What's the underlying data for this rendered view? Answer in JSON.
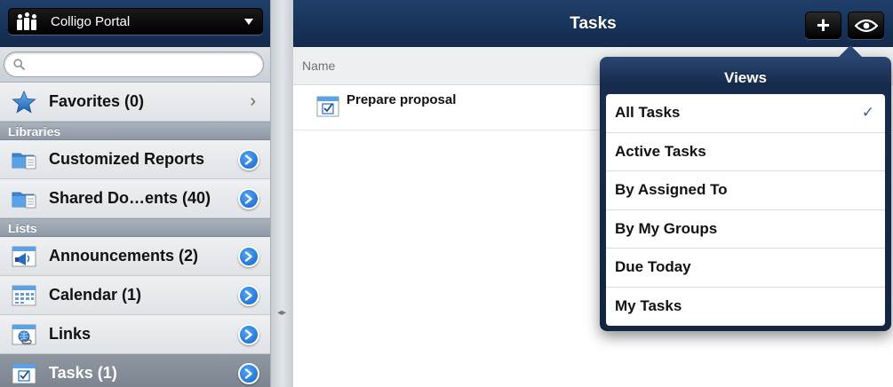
{
  "sidebar": {
    "portal_label": "Colligo Portal",
    "search_placeholder": "",
    "favorites": {
      "label": "Favorites (0)"
    },
    "libraries_header": "Libraries",
    "libraries": [
      {
        "label": "Customized Reports",
        "icon": "folder-doc-icon"
      },
      {
        "label": "Shared Do…ents (40)",
        "icon": "folder-doc-icon"
      }
    ],
    "lists_header": "Lists",
    "lists": [
      {
        "label": "Announcements (2)",
        "icon": "megaphone-icon"
      },
      {
        "label": "Calendar (1)",
        "icon": "calendar-icon"
      },
      {
        "label": "Links",
        "icon": "link-icon"
      },
      {
        "label": "Tasks (1)",
        "icon": "task-icon",
        "selected": true
      }
    ]
  },
  "main": {
    "title": "Tasks",
    "add_button": "+",
    "column_header": "Name",
    "tasks": [
      {
        "label": "Prepare proposal"
      }
    ]
  },
  "views_popover": {
    "title": "Views",
    "items": [
      {
        "label": "All Tasks",
        "checked": true
      },
      {
        "label": "Active Tasks"
      },
      {
        "label": "By Assigned To"
      },
      {
        "label": "By My Groups"
      },
      {
        "label": "Due Today"
      },
      {
        "label": "My Tasks"
      }
    ],
    "check_mark": "✓"
  },
  "colors": {
    "toolbar": "#1a355d",
    "selected_row": "#848d98",
    "disclosure_blue": "#1f77d6"
  }
}
